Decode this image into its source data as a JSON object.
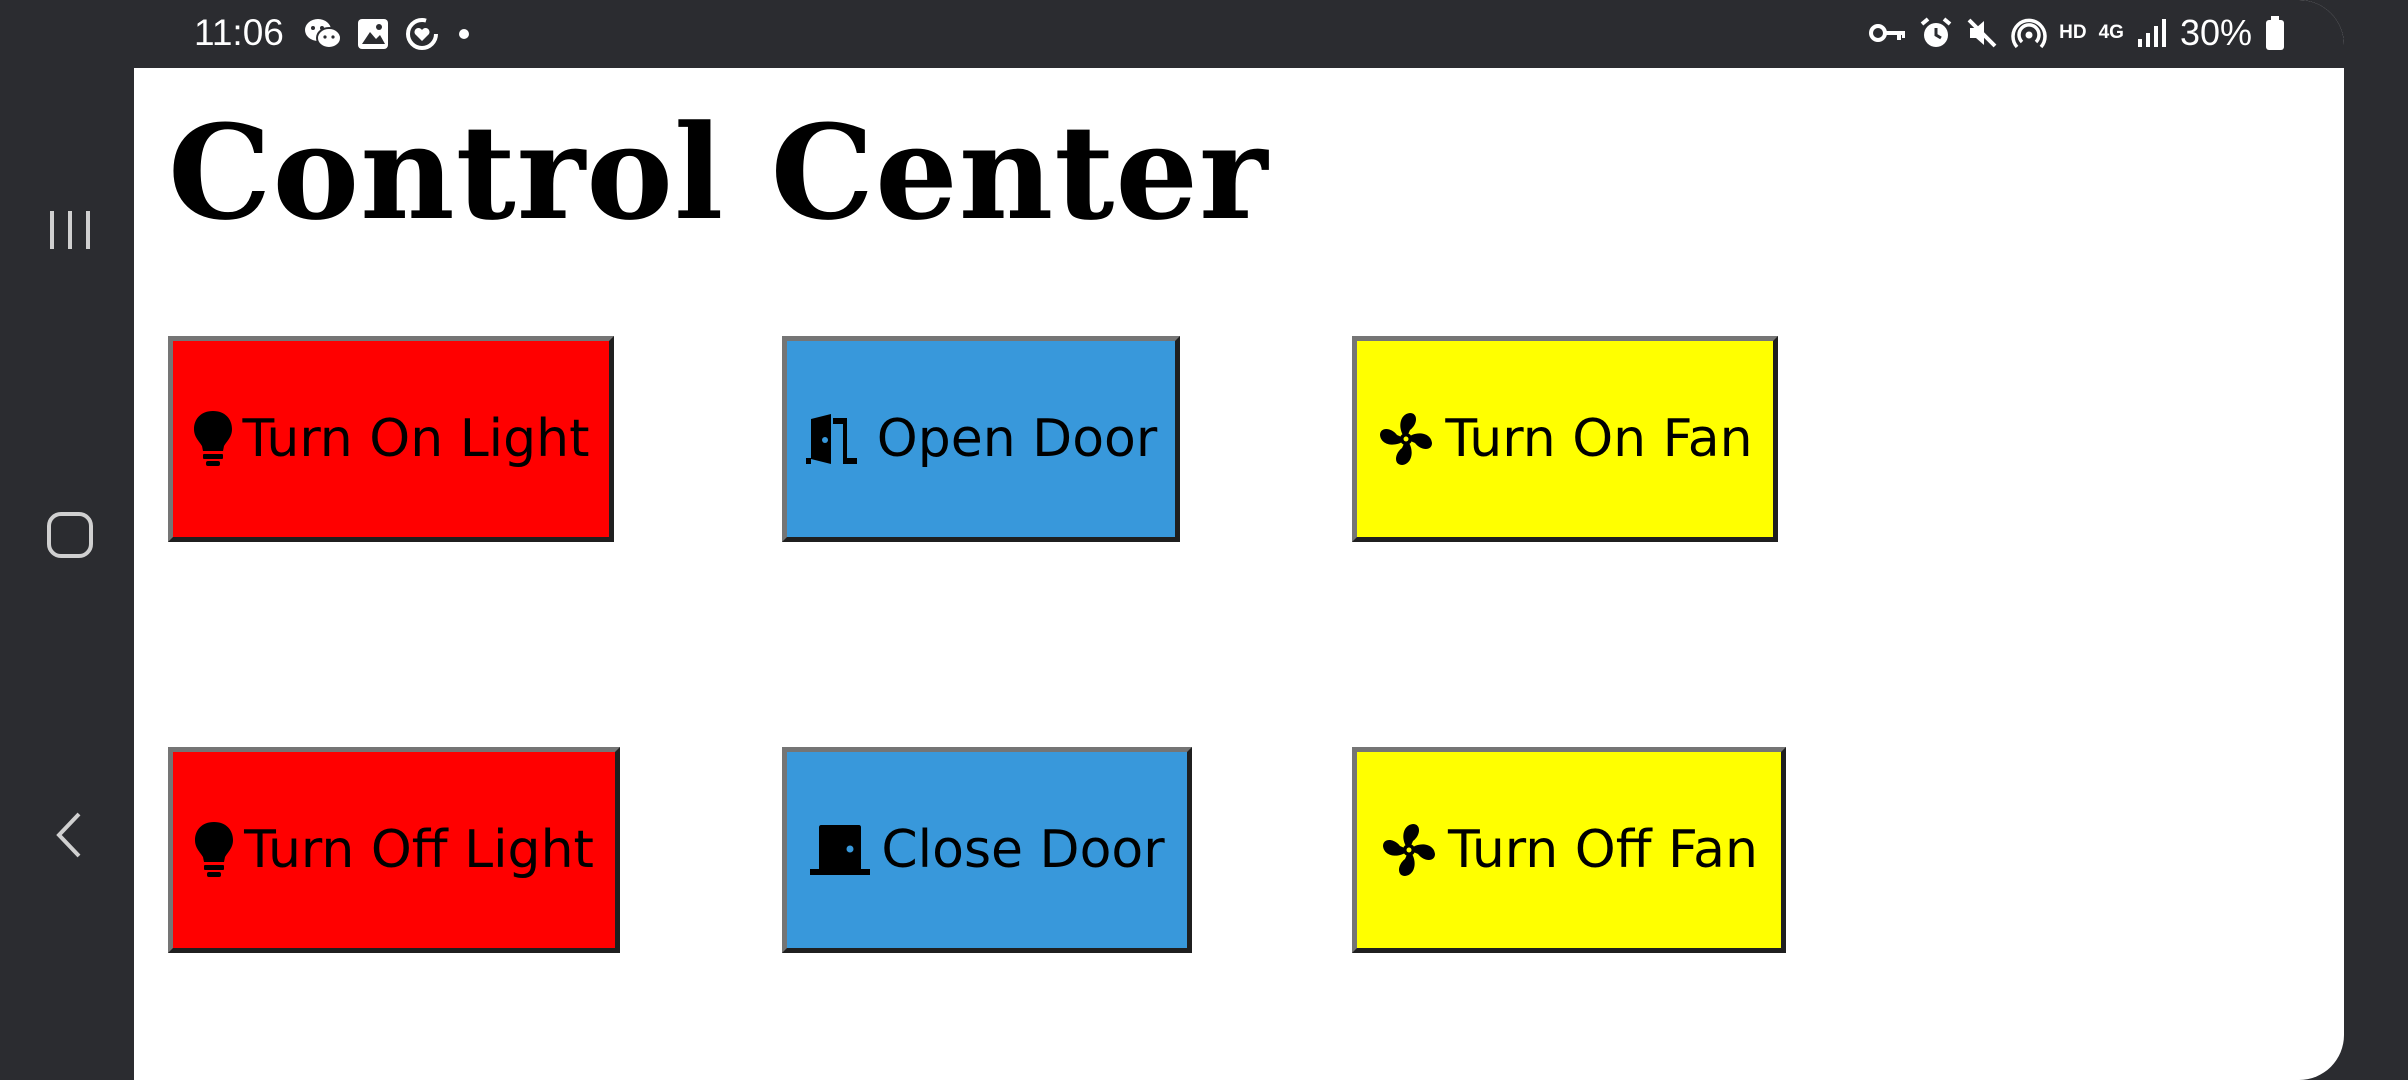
{
  "status_bar": {
    "time": "11:06",
    "battery": "30%",
    "network_tag": "HD",
    "network_gen": "4G"
  },
  "page": {
    "title": "Control Center"
  },
  "colors": {
    "light": "#ff0000",
    "door": "#3898db",
    "fan": "#ffff00"
  },
  "buttons": {
    "turn_on_light": "Turn On Light",
    "open_door": "Open Door",
    "turn_on_fan": "Turn On Fan",
    "turn_off_light": "Turn Off Light",
    "close_door": "Close Door",
    "turn_off_fan": "Turn Off Fan"
  }
}
